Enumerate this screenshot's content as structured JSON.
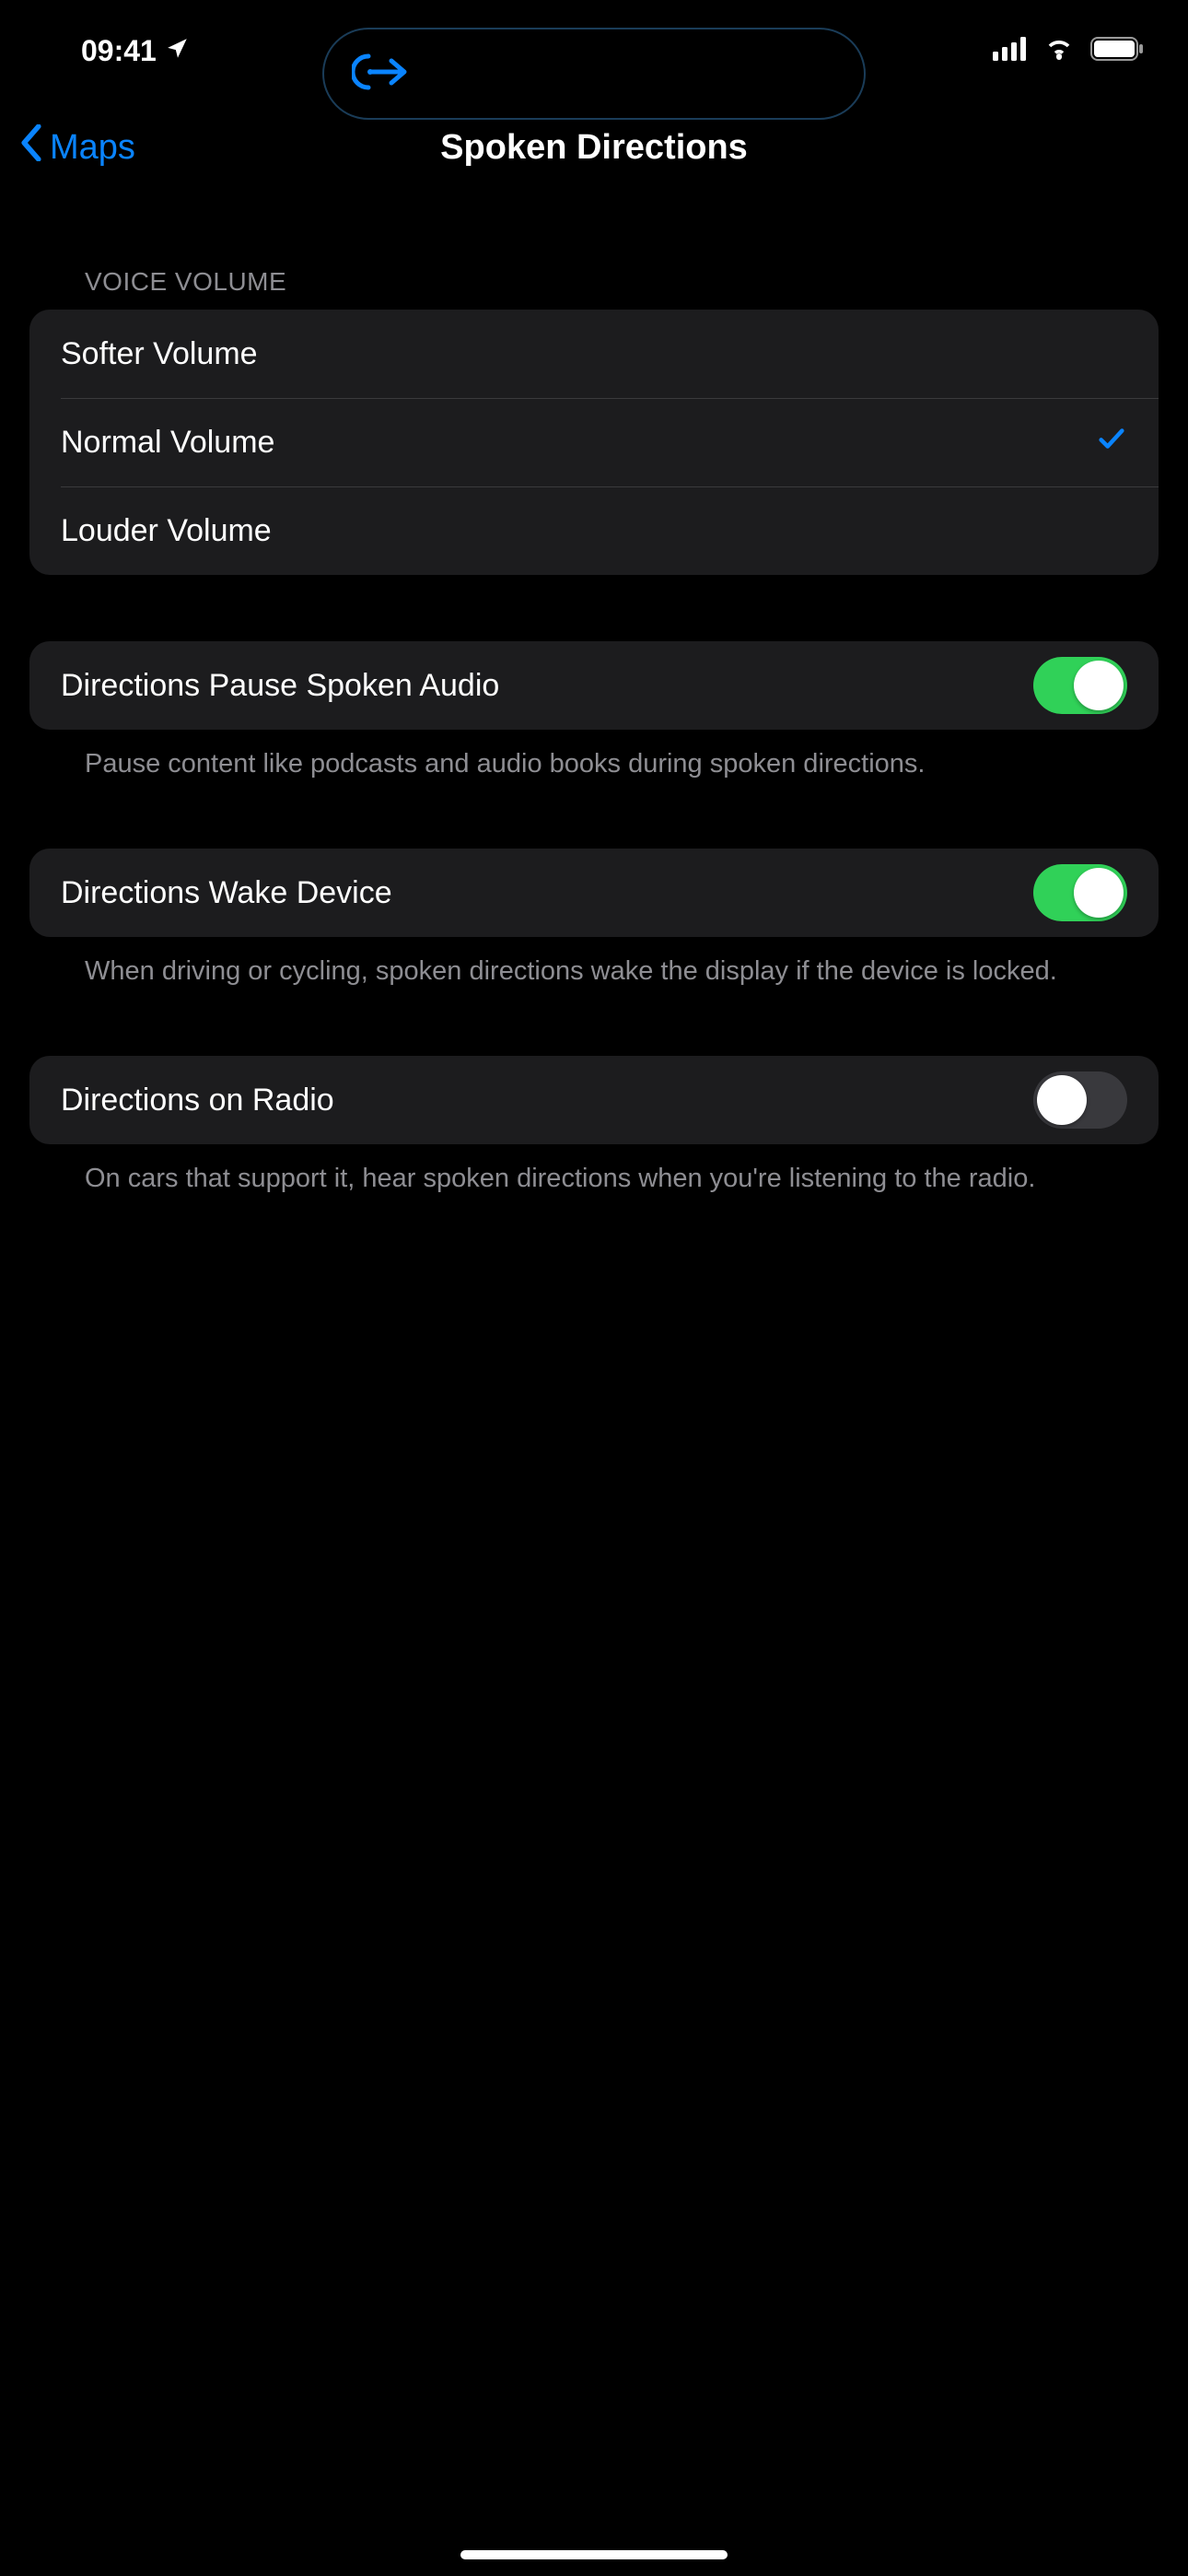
{
  "status": {
    "time": "09:41"
  },
  "nav": {
    "back_label": "Maps",
    "title": "Spoken Directions"
  },
  "sections": {
    "voice_volume": {
      "header": "VOICE VOLUME",
      "options": [
        {
          "label": "Softer Volume",
          "selected": false
        },
        {
          "label": "Normal Volume",
          "selected": true
        },
        {
          "label": "Louder Volume",
          "selected": false
        }
      ]
    },
    "toggles": [
      {
        "label": "Directions Pause Spoken Audio",
        "on": true,
        "footer": "Pause content like podcasts and audio books during spoken directions."
      },
      {
        "label": "Directions Wake Device",
        "on": true,
        "footer": "When driving or cycling, spoken directions wake the display if the device is locked."
      },
      {
        "label": "Directions on Radio",
        "on": false,
        "footer": "On cars that support it, hear spoken directions when you're listening to the radio."
      }
    ]
  }
}
